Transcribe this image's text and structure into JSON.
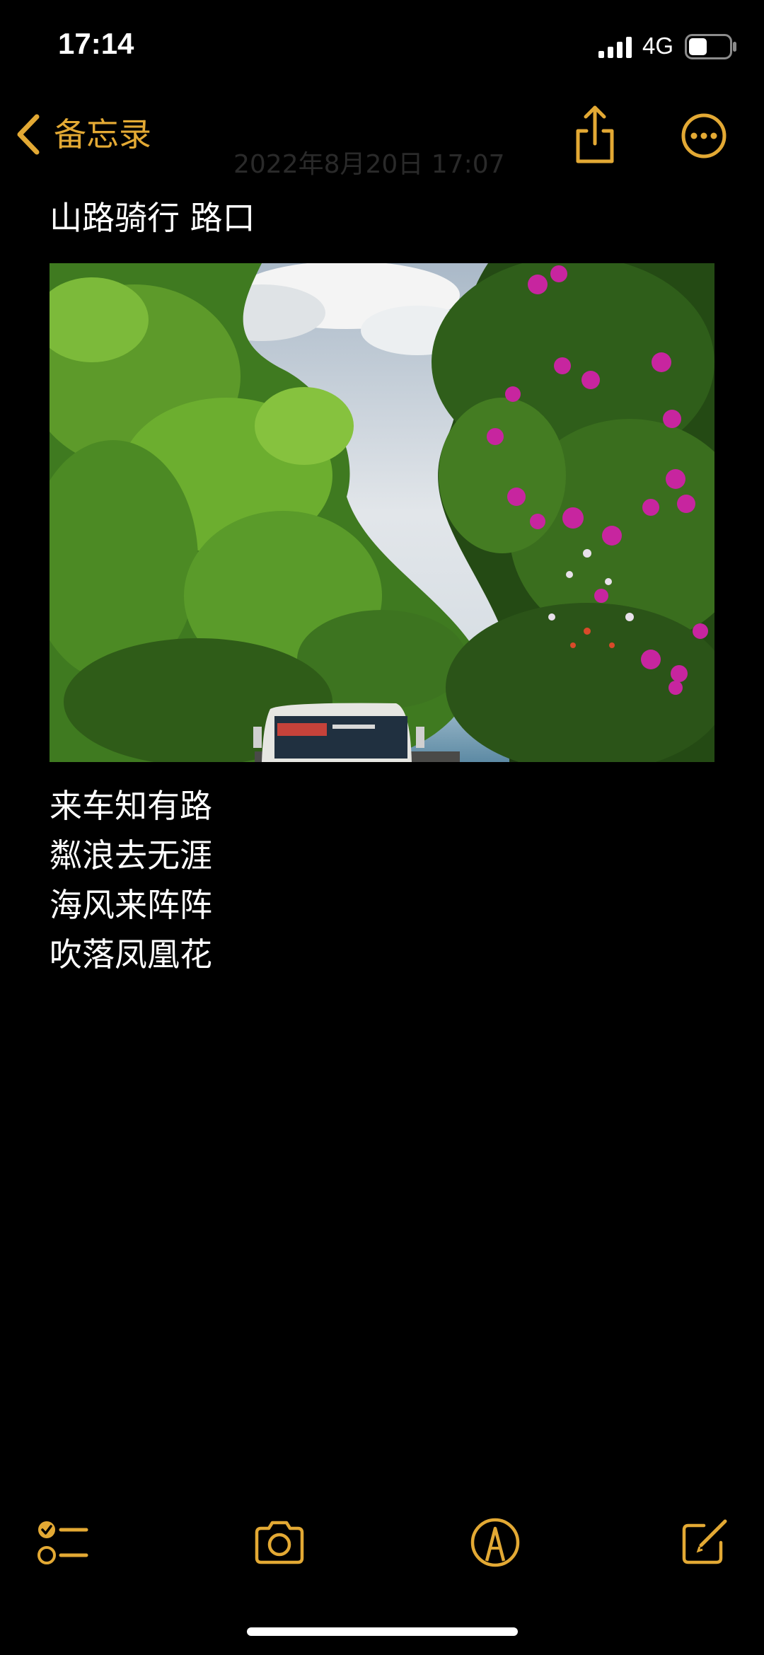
{
  "status_bar": {
    "time": "17:14",
    "network": "4G",
    "battery_level": 0.45
  },
  "nav": {
    "back_label": "备忘录",
    "ghost_date": "2022年8月20日 17:07"
  },
  "note": {
    "title": "山路骑行 路口",
    "image_icon": "photo-of-tree-tunnel-with-bus-and-sea",
    "lines": [
      "来车知有路",
      "粼浪去无涯",
      "海风来阵阵",
      "吹落凤凰花"
    ]
  },
  "icons": {
    "back": "chevron-left-icon",
    "share": "share-icon",
    "more": "more-icon",
    "checklist": "checklist-icon",
    "camera": "camera-icon",
    "markup": "markup-pen-icon",
    "compose": "compose-icon"
  },
  "colors": {
    "accent": "#E3A934",
    "background": "#000000",
    "text": "#FFFFFF"
  }
}
